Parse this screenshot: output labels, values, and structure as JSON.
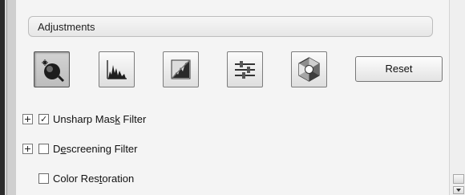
{
  "section": {
    "title": "Adjustments"
  },
  "toolbar": {
    "buttons": [
      {
        "icon": "auto-exposure-icon",
        "active": true
      },
      {
        "icon": "histogram-icon",
        "active": false
      },
      {
        "icon": "tone-curve-icon",
        "active": false
      },
      {
        "icon": "image-adjustment-sliders-icon",
        "active": false
      },
      {
        "icon": "color-palette-icon",
        "active": false
      }
    ],
    "reset_label": "Reset"
  },
  "options": [
    {
      "expandable": true,
      "checked": true,
      "label_pre": "Unsharp Mas",
      "label_mnemonic": "k",
      "label_post": " Filter"
    },
    {
      "expandable": true,
      "checked": false,
      "label_pre": "D",
      "label_mnemonic": "e",
      "label_post": "screening Filter"
    },
    {
      "expandable": false,
      "checked": false,
      "label_pre": "Color Res",
      "label_mnemonic": "t",
      "label_post": "oration"
    }
  ],
  "colors": {
    "panel": "#f4f4f4",
    "border": "#7c7c7c",
    "accent": "#2d2d2d"
  }
}
